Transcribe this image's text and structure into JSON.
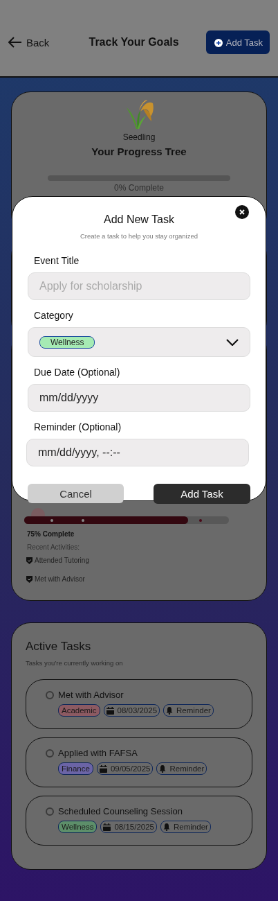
{
  "header": {
    "back_label": "Back",
    "title": "Track Your Goals",
    "add_button": "Add Task"
  },
  "progress_tree": {
    "stage": "Seedling",
    "title": "Your Progress Tree",
    "level": 0,
    "reading": "0% Complete"
  },
  "goal_card": {
    "level": 0.8,
    "reading": "75% Complete",
    "activities_label": "Recent Activities:",
    "activities": [
      "Attended Tutoring",
      "Met with Advisor"
    ]
  },
  "active_tasks": {
    "title": "Active Tasks",
    "subtitle": "Tasks you’re currently working on",
    "tasks": [
      {
        "title": "Met with Advisor",
        "checked": false,
        "category": "Academic",
        "color": "#8c5a62",
        "date": "08/03/2025",
        "reminder": "Reminder"
      },
      {
        "title": "Applied with FAFSA",
        "checked": false,
        "category": "Finance",
        "color": "#6b64a6",
        "date": "09/05/2025",
        "reminder": "Reminder"
      },
      {
        "title": "Scheduled Counseling Session",
        "checked": false,
        "category": "Wellness",
        "color": "#5d8f6a",
        "date": "08/15/2025",
        "reminder": "Reminder"
      }
    ]
  },
  "modal": {
    "title": "Add New Task",
    "subtitle": "Create a task to help you stay organized",
    "fields": [
      {
        "kind": "text",
        "label": "Event Title",
        "placeholder": "Apply for scholarship"
      },
      {
        "kind": "select",
        "label": "Category",
        "value": "Wellness",
        "color": "#a6ebb4"
      },
      {
        "kind": "date",
        "label": "Due Date (Optional)",
        "value": "mm/dd/yyyy"
      },
      {
        "kind": "datetime",
        "label": "Reminder (Optional)",
        "value": "mm/dd/yyyy, --:--"
      }
    ],
    "cancel_button": "Cancel",
    "submit_button": "Add Task"
  }
}
